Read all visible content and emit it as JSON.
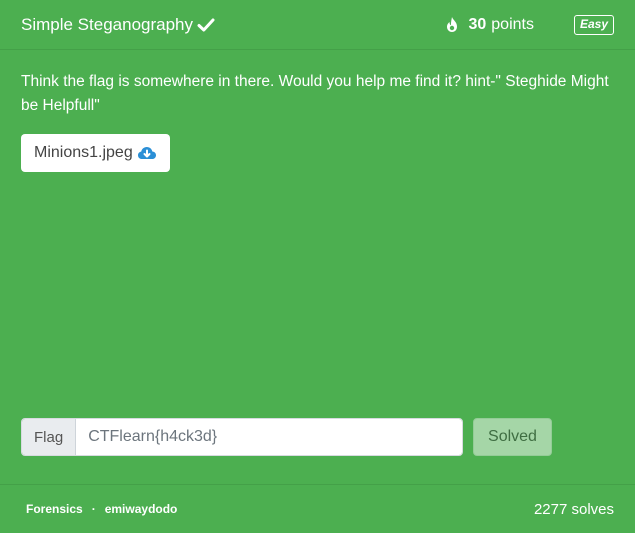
{
  "challenge": {
    "title": "Simple Steganography",
    "points": "30",
    "points_label": "points",
    "difficulty": "Easy",
    "description": "Think the flag is somewhere in there. Would you help me find it? hint-\" Steghide Might be Helpfull\"",
    "file_name": "Minions1.jpeg"
  },
  "flag_form": {
    "label": "Flag",
    "value": "CTFlearn{h4ck3d}",
    "button": "Solved"
  },
  "footer": {
    "category": "Forensics",
    "separator": "·",
    "author": "emiwaydodo",
    "solves": "2277 solves"
  },
  "colors": {
    "card_background": "#4caf50",
    "solved_button": "#a5d6a7",
    "download_icon": "#2b8fd6"
  },
  "icons": {
    "solved": "check-icon",
    "points": "fire-icon",
    "file": "cloud-download-icon"
  }
}
